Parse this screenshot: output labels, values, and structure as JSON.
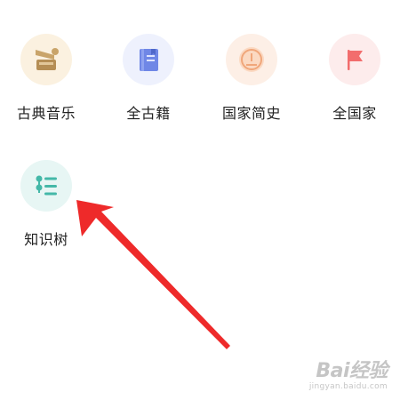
{
  "apps": [
    {
      "label": "古典音乐",
      "icon": "gramophone-icon",
      "color": "#c9a46a"
    },
    {
      "label": "全古籍",
      "icon": "book-icon",
      "color": "#6f87e6"
    },
    {
      "label": "国家简史",
      "icon": "coin-icon",
      "color": "#f0a67a"
    },
    {
      "label": "全国家",
      "icon": "flag-icon",
      "color": "#f26d6d"
    },
    {
      "label": "知识树",
      "icon": "tree-list-icon",
      "color": "#44b8a8"
    }
  ],
  "annotation": {
    "arrow_color": "#ee2a2a"
  },
  "watermark": {
    "brand": "Bai经验",
    "url": "jingyan.baidu.com"
  }
}
